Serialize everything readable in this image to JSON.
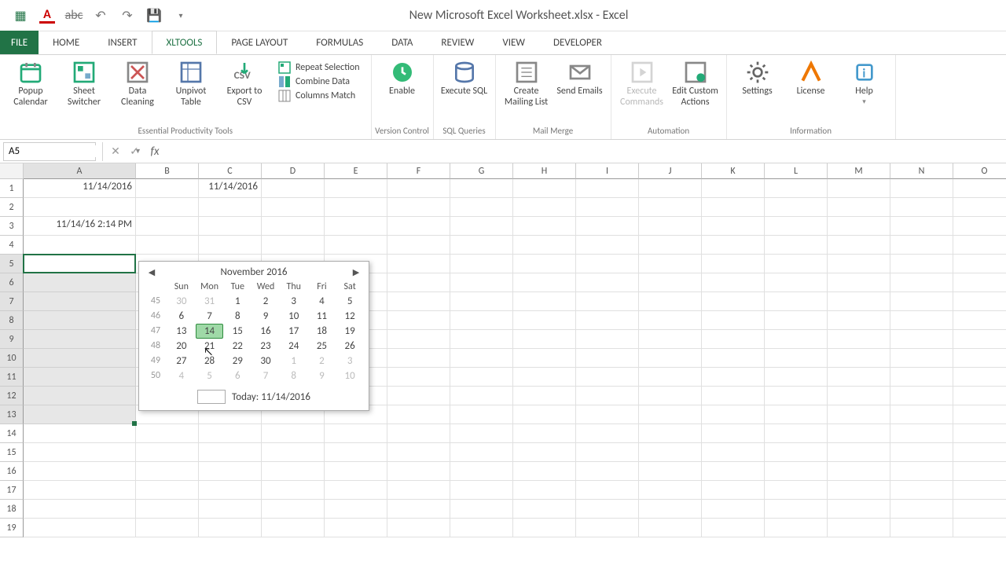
{
  "title": "New Microsoft Excel Worksheet.xlsx - Excel",
  "tabs": {
    "file": "FILE",
    "list": [
      "HOME",
      "INSERT",
      "XLTools",
      "PAGE LAYOUT",
      "FORMULAS",
      "DATA",
      "REVIEW",
      "VIEW",
      "DEVELOPER"
    ],
    "active": "XLTools"
  },
  "ribbon": {
    "groups": [
      {
        "label": "Essential Productivity Tools",
        "big": [
          {
            "name": "popup-calendar",
            "label": "Popup Calendar"
          },
          {
            "name": "sheet-switcher",
            "label": "Sheet Switcher"
          },
          {
            "name": "data-cleaning",
            "label": "Data Cleaning"
          },
          {
            "name": "unpivot-table",
            "label": "Unpivot Table"
          },
          {
            "name": "export-csv",
            "label": "Export to CSV"
          }
        ],
        "thin": [
          {
            "name": "repeat-selection",
            "label": "Repeat Selection"
          },
          {
            "name": "combine-data",
            "label": "Combine Data"
          },
          {
            "name": "columns-match",
            "label": "Columns Match"
          }
        ]
      },
      {
        "label": "Version Control",
        "big": [
          {
            "name": "enable-vc",
            "label": "Enable"
          }
        ]
      },
      {
        "label": "SQL Queries",
        "big": [
          {
            "name": "execute-sql",
            "label": "Execute SQL"
          }
        ]
      },
      {
        "label": "Mail Merge",
        "big": [
          {
            "name": "create-mailing",
            "label": "Create Mailing List"
          },
          {
            "name": "send-emails",
            "label": "Send Emails"
          }
        ]
      },
      {
        "label": "Automation",
        "big": [
          {
            "name": "execute-commands",
            "label": "Execute Commands",
            "disabled": true
          },
          {
            "name": "edit-actions",
            "label": "Edit Custom Actions"
          }
        ]
      },
      {
        "label": "Information",
        "big": [
          {
            "name": "settings",
            "label": "Settings"
          },
          {
            "name": "license",
            "label": "License"
          },
          {
            "name": "help",
            "label": "Help",
            "dropdown": true
          }
        ]
      }
    ]
  },
  "formula_bar": {
    "namebox": "A5",
    "formula": ""
  },
  "columns": [
    "A",
    "B",
    "C",
    "D",
    "E",
    "F",
    "G",
    "H",
    "I",
    "J",
    "K",
    "L",
    "M",
    "N",
    "O"
  ],
  "rows": 19,
  "cells": {
    "A1": "11/14/2016",
    "C1": "11/14/2016",
    "A3": "11/14/16 2:14 PM"
  },
  "selection": {
    "active": "A5",
    "range_rows": [
      5,
      13
    ],
    "col": "A"
  },
  "calendar": {
    "month": "November 2016",
    "day_headers": [
      "Sun",
      "Mon",
      "Tue",
      "Wed",
      "Thu",
      "Fri",
      "Sat"
    ],
    "weeks": [
      {
        "wn": 45,
        "days": [
          {
            "n": 30,
            "o": true
          },
          {
            "n": 31,
            "o": true
          },
          {
            "n": 1
          },
          {
            "n": 2
          },
          {
            "n": 3
          },
          {
            "n": 4
          },
          {
            "n": 5
          }
        ]
      },
      {
        "wn": 46,
        "days": [
          {
            "n": 6
          },
          {
            "n": 7
          },
          {
            "n": 8
          },
          {
            "n": 9
          },
          {
            "n": 10
          },
          {
            "n": 11
          },
          {
            "n": 12
          }
        ]
      },
      {
        "wn": 47,
        "days": [
          {
            "n": 13
          },
          {
            "n": 14,
            "today": true
          },
          {
            "n": 15
          },
          {
            "n": 16
          },
          {
            "n": 17
          },
          {
            "n": 18
          },
          {
            "n": 19
          }
        ]
      },
      {
        "wn": 48,
        "days": [
          {
            "n": 20
          },
          {
            "n": 21
          },
          {
            "n": 22
          },
          {
            "n": 23
          },
          {
            "n": 24
          },
          {
            "n": 25
          },
          {
            "n": 26
          }
        ]
      },
      {
        "wn": 49,
        "days": [
          {
            "n": 27
          },
          {
            "n": 28
          },
          {
            "n": 29
          },
          {
            "n": 30
          },
          {
            "n": 1,
            "o": true
          },
          {
            "n": 2,
            "o": true
          },
          {
            "n": 3,
            "o": true
          }
        ]
      },
      {
        "wn": 50,
        "days": [
          {
            "n": 4,
            "o": true
          },
          {
            "n": 5,
            "o": true
          },
          {
            "n": 6,
            "o": true
          },
          {
            "n": 7,
            "o": true
          },
          {
            "n": 8,
            "o": true
          },
          {
            "n": 9,
            "o": true
          },
          {
            "n": 10,
            "o": true
          }
        ]
      }
    ],
    "today_label": "Today: 11/14/2016"
  }
}
